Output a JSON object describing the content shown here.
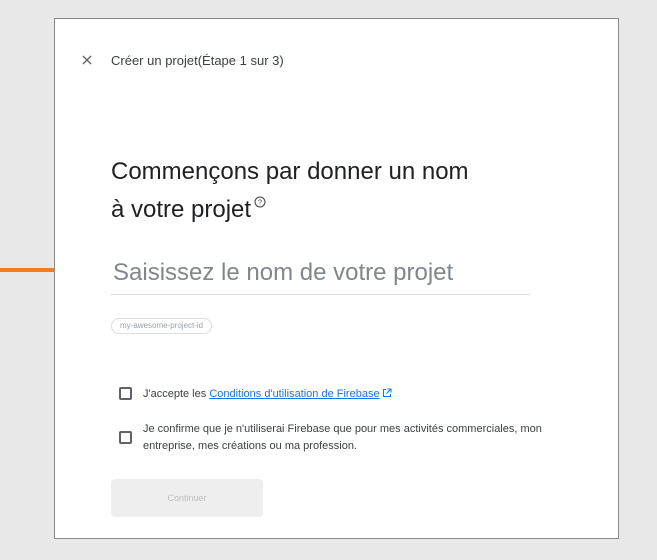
{
  "header": {
    "title": "Créer un projet(Étape 1 sur 3)",
    "close_icon": "close-icon"
  },
  "heading": {
    "text": "Commençons par donner un nom à votre projet",
    "help_icon": "help-icon"
  },
  "project_name": {
    "value": "",
    "placeholder": "Saisissez le nom de votre projet"
  },
  "project_id": "my-awesome-project-id",
  "terms": {
    "prefix": "J'accepte les ",
    "link": "Conditions d'utilisation de Firebase",
    "link_icon": "external-link-icon",
    "checked": false
  },
  "business_use": {
    "text": "Je confirme que je n'utiliserai Firebase que pour mes activités commerciales, mon entreprise, mes créations ou ma profession.",
    "checked": false
  },
  "continue_button": "Continuer",
  "colors": {
    "arrow": "#f07d1f",
    "link": "#1a73e8"
  }
}
